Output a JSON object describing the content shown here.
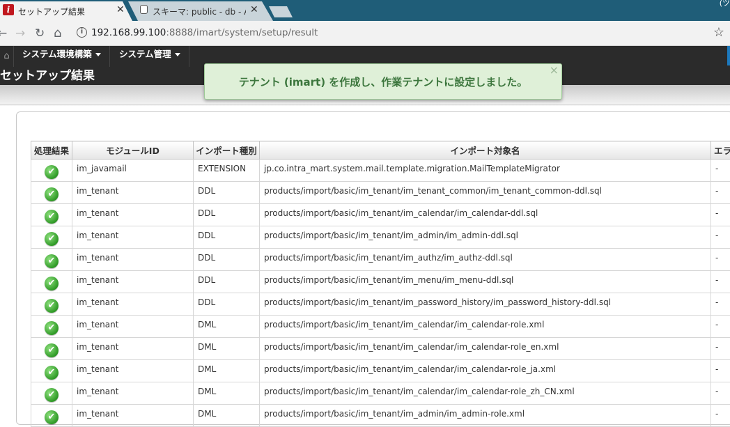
{
  "browser": {
    "tabs": [
      {
        "title": "セットアップ結果",
        "icon": "intra-mart-favicon-icon",
        "active": true
      },
      {
        "title": "スキーマ: public - db - Adm",
        "icon": "pgadmin-favicon-icon",
        "active": false
      }
    ],
    "window_control_text": "(ツ",
    "url_host": "192.168.99.100",
    "url_rest": ":8888/imart/system/setup/result"
  },
  "nav": {
    "menus": [
      "システム環境構築",
      "システム管理"
    ]
  },
  "page": {
    "title": "セットアップ結果"
  },
  "toast": {
    "message": "テナント (imart) を作成し、作業テナントに設定しました。",
    "close": "×"
  },
  "table": {
    "headers": [
      "処理結果",
      "モジュールID",
      "インポート種別",
      "インポート対象名",
      "エラ"
    ],
    "rows": [
      {
        "module": "im_javamail",
        "type": "EXTENSION",
        "target": "jp.co.intra_mart.system.mail.template.migration.MailTemplateMigrator",
        "error": "-"
      },
      {
        "module": "im_tenant",
        "type": "DDL",
        "target": "products/import/basic/im_tenant/im_tenant_common/im_tenant_common-ddl.sql",
        "error": "-"
      },
      {
        "module": "im_tenant",
        "type": "DDL",
        "target": "products/import/basic/im_tenant/im_calendar/im_calendar-ddl.sql",
        "error": "-"
      },
      {
        "module": "im_tenant",
        "type": "DDL",
        "target": "products/import/basic/im_tenant/im_admin/im_admin-ddl.sql",
        "error": "-"
      },
      {
        "module": "im_tenant",
        "type": "DDL",
        "target": "products/import/basic/im_tenant/im_authz/im_authz-ddl.sql",
        "error": "-"
      },
      {
        "module": "im_tenant",
        "type": "DDL",
        "target": "products/import/basic/im_tenant/im_menu/im_menu-ddl.sql",
        "error": "-"
      },
      {
        "module": "im_tenant",
        "type": "DDL",
        "target": "products/import/basic/im_tenant/im_password_history/im_password_history-ddl.sql",
        "error": "-"
      },
      {
        "module": "im_tenant",
        "type": "DML",
        "target": "products/import/basic/im_tenant/im_calendar/im_calendar-role.xml",
        "error": "-"
      },
      {
        "module": "im_tenant",
        "type": "DML",
        "target": "products/import/basic/im_tenant/im_calendar/im_calendar-role_en.xml",
        "error": "-"
      },
      {
        "module": "im_tenant",
        "type": "DML",
        "target": "products/import/basic/im_tenant/im_calendar/im_calendar-role_ja.xml",
        "error": "-"
      },
      {
        "module": "im_tenant",
        "type": "DML",
        "target": "products/import/basic/im_tenant/im_calendar/im_calendar-role_zh_CN.xml",
        "error": "-"
      },
      {
        "module": "im_tenant",
        "type": "DML",
        "target": "products/import/basic/im_tenant/im_admin/im_admin-role.xml",
        "error": "-"
      }
    ],
    "status_icon": "check-circle-icon"
  },
  "colors": {
    "tabbar": "#1f5d78",
    "appnav": "#2b2b2b",
    "toast_bg": "#dff0d8",
    "toast_text": "#3c763d",
    "ok_green": "#2f9a26"
  }
}
